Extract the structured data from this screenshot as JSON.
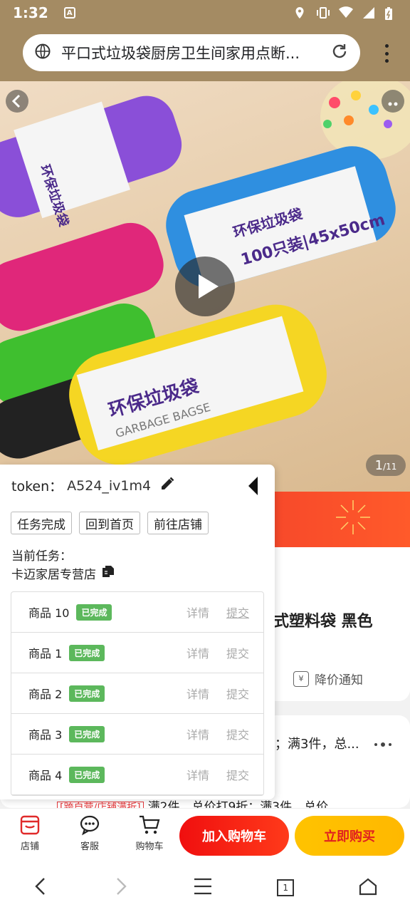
{
  "status_bar": {
    "time": "1:32",
    "a_icon": "A"
  },
  "browser": {
    "url_text": "平口式垃圾袋厨房卫生间家用点断..."
  },
  "product_image": {
    "counter_current": "1",
    "counter_total": "/11",
    "band_text_1": "100只装|45x50cm",
    "band_text_2": "环保垃圾袋",
    "band_text_3": "GARBAGE BAGSE"
  },
  "page": {
    "product_title": "式塑料袋 黑色",
    "price_alert": "降价通知",
    "price_alert_icon": "¥",
    "promo_text": "；满3件，总...",
    "bottom_promo_tag": "[跨自营/店铺满折]",
    "bottom_promo_text": "满2件，总价打9折；满3件，总价"
  },
  "action_bar": {
    "store_label": "店铺",
    "service_label": "客服",
    "cart_label": "购物车",
    "add_to_cart": "加入购物车",
    "buy_now": "立即购买"
  },
  "nav": {
    "tabs_count": "1"
  },
  "panel": {
    "token_label": "token：",
    "token_value": "A524_iv1m4",
    "buttons": [
      "任务完成",
      "回到首页",
      "前往店铺"
    ],
    "task_label": "当前任务：",
    "task_store": "卡迈家居专营店",
    "items": [
      {
        "name": "商品 10",
        "status": "已完成",
        "detail": "详情",
        "submit": "提交"
      },
      {
        "name": "商品 1",
        "status": "已完成",
        "detail": "详情",
        "submit": "提交"
      },
      {
        "name": "商品 2",
        "status": "已完成",
        "detail": "详情",
        "submit": "提交"
      },
      {
        "name": "商品 3",
        "status": "已完成",
        "detail": "详情",
        "submit": "提交"
      },
      {
        "name": "商品 4",
        "status": "已完成",
        "detail": "详情",
        "submit": "提交"
      }
    ]
  },
  "colors": {
    "status_bar": "#a48b63",
    "add_to_cart": "#f00f0f",
    "buy_now": "#ffc300",
    "badge_done": "#5cb85c"
  }
}
